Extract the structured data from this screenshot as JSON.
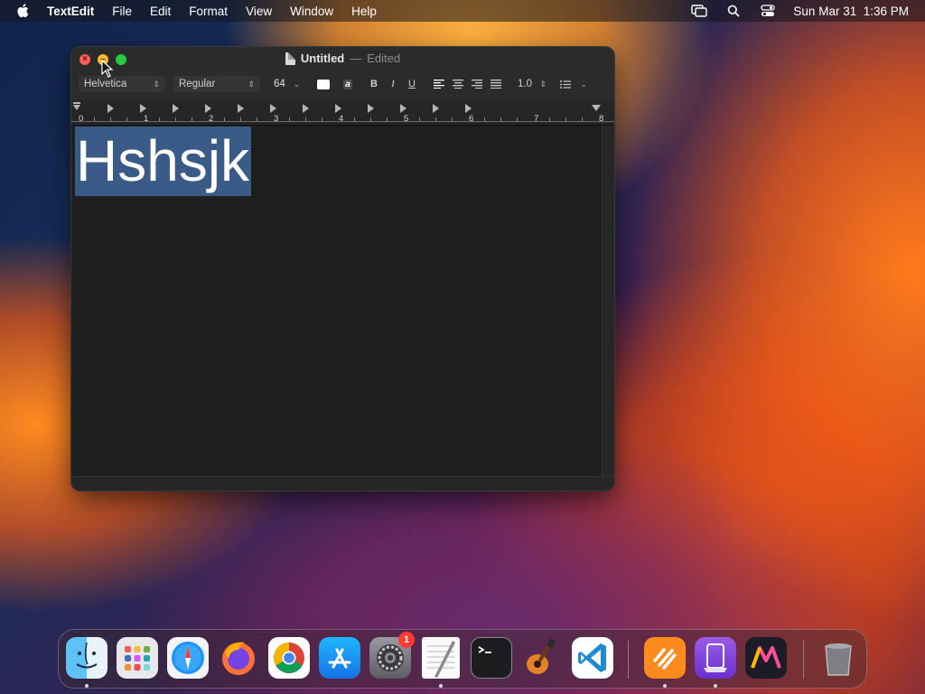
{
  "menubar": {
    "app_name": "TextEdit",
    "items": [
      "File",
      "Edit",
      "Format",
      "View",
      "Window",
      "Help"
    ],
    "datetime": "Sun Mar 31  1:36 PM",
    "status_icons": [
      "screen-mirroring-icon",
      "search-icon",
      "control-center-icon"
    ]
  },
  "window": {
    "title": "Untitled",
    "separator": "—",
    "status": "Edited"
  },
  "toolbar": {
    "font_family": "Helvetica",
    "font_style": "Regular",
    "font_size": "64",
    "bold": "B",
    "italic": "I",
    "underline": "U",
    "line_spacing": "1.0",
    "text_color": "#ffffff",
    "highlight_glyph": "a"
  },
  "ruler": {
    "numbers": [
      "0",
      "1",
      "2",
      "3",
      "4",
      "5",
      "6",
      "7",
      "8"
    ]
  },
  "document": {
    "text": "Hshsjk",
    "selection_color": "#3a5a88"
  },
  "dock": {
    "apps": [
      "Finder",
      "Launchpad",
      "Safari",
      "Firefox",
      "Google Chrome",
      "App Store",
      "System Settings",
      "TextEdit",
      "Terminal",
      "GarageBand",
      "Visual Studio Code",
      "Sublime Text",
      "Simulator",
      "Marker",
      "Trash"
    ],
    "system_settings_badge": "1"
  }
}
